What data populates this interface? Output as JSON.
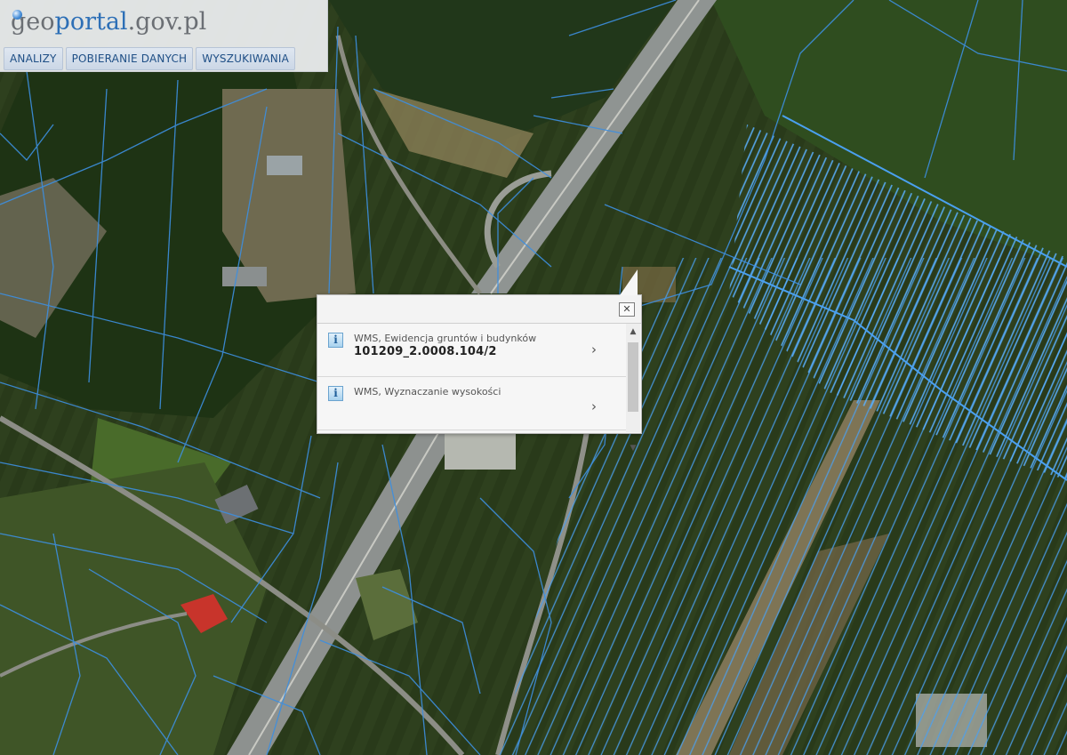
{
  "header": {
    "logo_part1": "geo",
    "logo_part2": "portal",
    "logo_part3": ".gov.pl",
    "nav": [
      {
        "label": "ANALIZY"
      },
      {
        "label": "POBIERANIE DANYCH"
      },
      {
        "label": "WYSZUKIWANIA"
      }
    ]
  },
  "popup": {
    "close_label": "✕",
    "results": [
      {
        "title": "WMS, Ewidencja gruntów i budynków",
        "value": "101209_2.0008.104/2",
        "icon": "info-icon"
      },
      {
        "title": "WMS, Wyznaczanie wysokości",
        "value": "",
        "icon": "info-icon"
      }
    ],
    "chevron": "›",
    "scroll_up": "▲",
    "scroll_down": "▼"
  },
  "colors": {
    "parcel_line": "#3d8fe0",
    "accent": "#2d6fb6"
  }
}
